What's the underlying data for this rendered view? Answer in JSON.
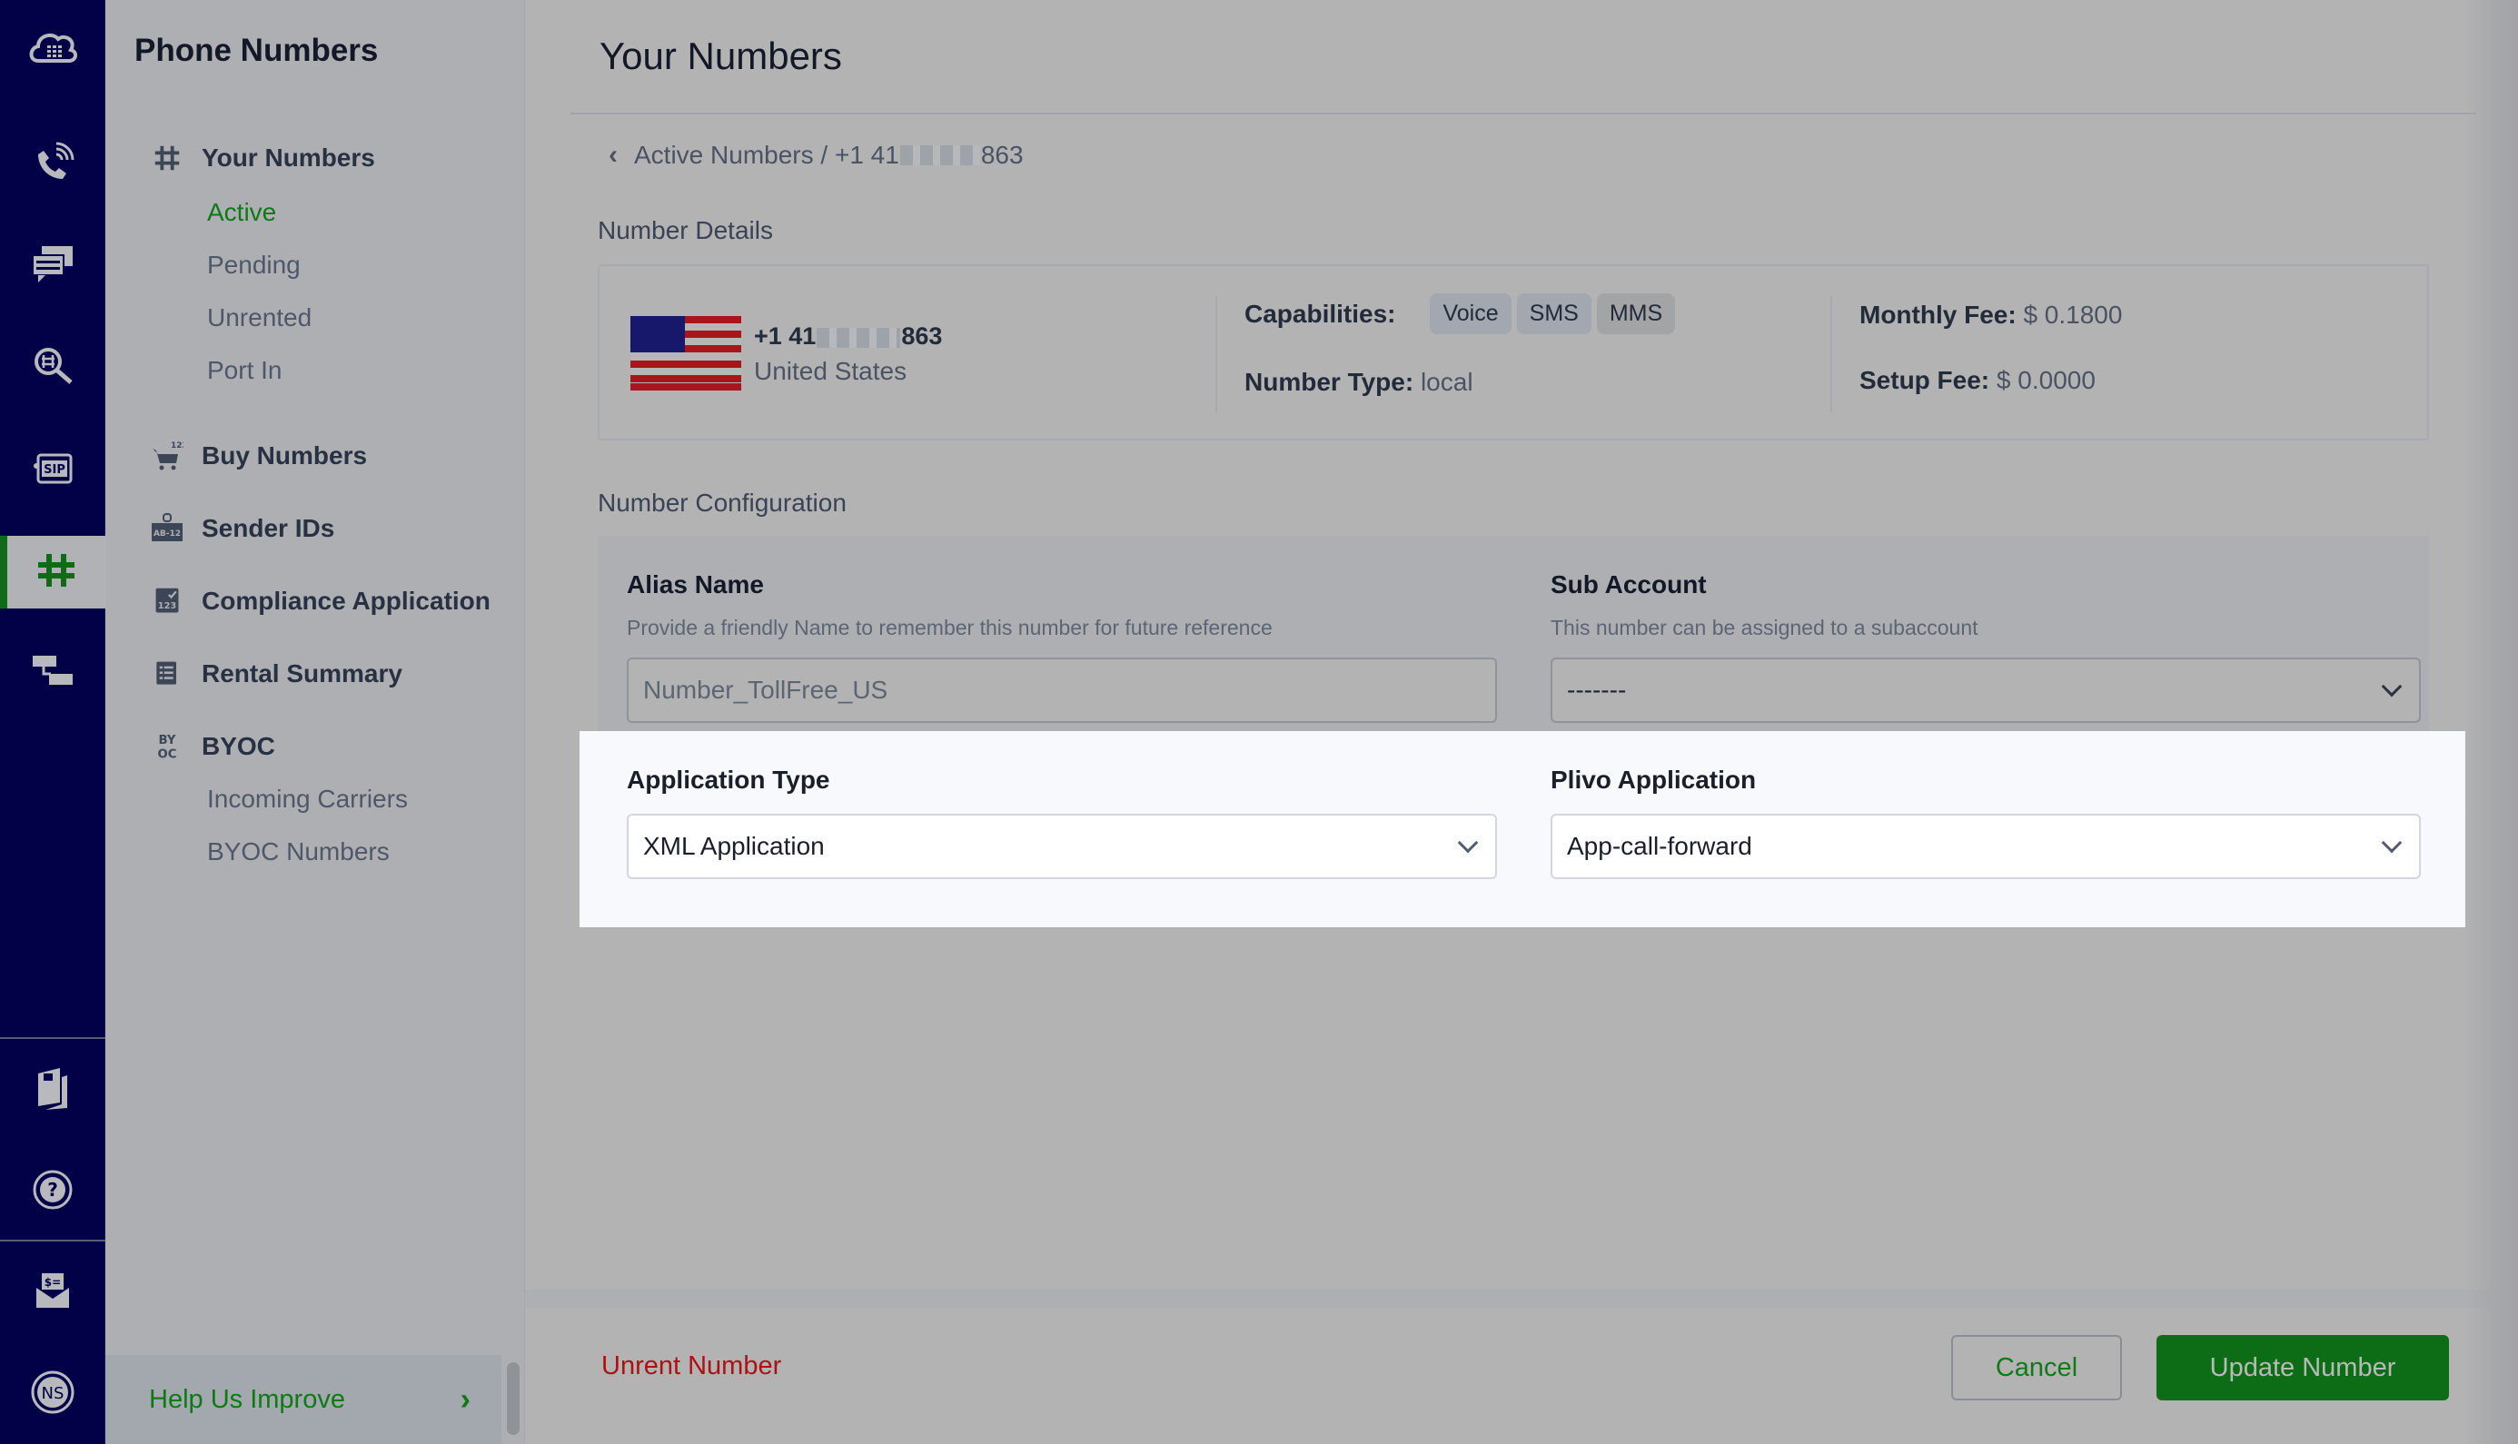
{
  "rail": {
    "items": [
      {
        "icon": "cloud-dialpad-icon"
      },
      {
        "icon": "phone-call-icon"
      },
      {
        "icon": "messaging-icon"
      },
      {
        "icon": "number-lookup-icon"
      },
      {
        "icon": "sip-trunk-icon"
      },
      {
        "icon": "phone-numbers-hash-icon",
        "active": true
      },
      {
        "icon": "flow-icon"
      },
      {
        "icon": "docs-icon"
      },
      {
        "icon": "help-icon"
      },
      {
        "icon": "billing-icon"
      },
      {
        "icon": "account-avatar-icon",
        "initials": "NS"
      }
    ]
  },
  "sidebar": {
    "title": "Phone Numbers",
    "groups": [
      {
        "label": "Your Numbers",
        "icon": "hash-icon",
        "sub": [
          "Active",
          "Pending",
          "Unrented",
          "Port In"
        ],
        "active_sub": "Active"
      },
      {
        "label": "Buy Numbers",
        "icon": "cart-123-icon"
      },
      {
        "label": "Sender IDs",
        "icon": "sender-id-badge-icon",
        "icon_text": "AB-12"
      },
      {
        "label": "Compliance Application",
        "icon": "compliance-icon",
        "icon_text": "123"
      },
      {
        "label": "Rental Summary",
        "icon": "list-icon"
      },
      {
        "label": "BYOC",
        "icon": "byoc-icon",
        "icon_text": "BYOC",
        "sub": [
          "Incoming Carriers",
          "BYOC Numbers"
        ]
      }
    ],
    "help": {
      "label": "Help Us Improve",
      "chevron": "›"
    }
  },
  "main": {
    "title": "Your Numbers",
    "breadcrumb": {
      "back": "‹",
      "parent": "Active Numbers",
      "sep": " / ",
      "number_prefix": "+1 41",
      "number_suffix": "863"
    },
    "details": {
      "section_label": "Number Details",
      "number_prefix": "+1 41",
      "number_suffix": "863",
      "country": "United States",
      "capabilities_label": "Capabilities:",
      "capabilities": [
        "Voice",
        "SMS",
        "MMS"
      ],
      "number_type_label": "Number Type:",
      "number_type": "local",
      "monthly_fee_label": "Monthly Fee:",
      "monthly_fee": "$ 0.1800",
      "setup_fee_label": "Setup Fee:",
      "setup_fee": "$ 0.0000"
    },
    "config": {
      "section_label": "Number Configuration",
      "alias": {
        "label": "Alias Name",
        "help": "Provide a friendly Name to remember this number for future reference",
        "placeholder": "Number_TollFree_US"
      },
      "sub_account": {
        "label": "Sub Account",
        "help": "This number can be assigned to a subaccount",
        "value": "-------"
      },
      "app_type": {
        "label": "Application Type",
        "value": "XML Application"
      },
      "plivo_app": {
        "label": "Plivo Application",
        "value": "App-call-forward"
      }
    },
    "footer": {
      "unrent": "Unrent Number",
      "cancel": "Cancel",
      "update": "Update Number"
    }
  }
}
